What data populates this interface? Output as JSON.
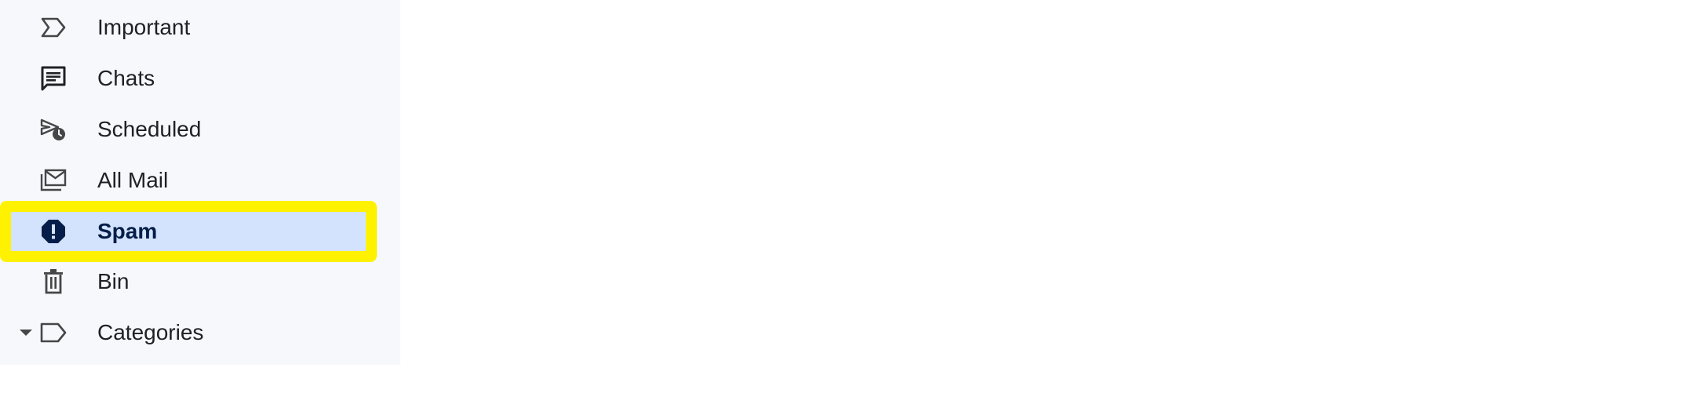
{
  "sidebar": {
    "items": [
      {
        "label": "Important",
        "icon": "important-icon",
        "active": false
      },
      {
        "label": "Chats",
        "icon": "chats-icon",
        "active": false
      },
      {
        "label": "Scheduled",
        "icon": "scheduled-icon",
        "active": false
      },
      {
        "label": "All Mail",
        "icon": "all-mail-icon",
        "active": false
      },
      {
        "label": "Spam",
        "icon": "spam-icon",
        "active": true
      },
      {
        "label": "Bin",
        "icon": "bin-icon",
        "active": false
      },
      {
        "label": "Categories",
        "icon": "label-icon",
        "active": false,
        "expandable": true
      }
    ]
  },
  "colors": {
    "sidebar_bg": "#f6f8fc",
    "active_bg": "#d3e3fd",
    "highlight": "#fff200",
    "text": "#202124",
    "active_text": "#041e49"
  }
}
